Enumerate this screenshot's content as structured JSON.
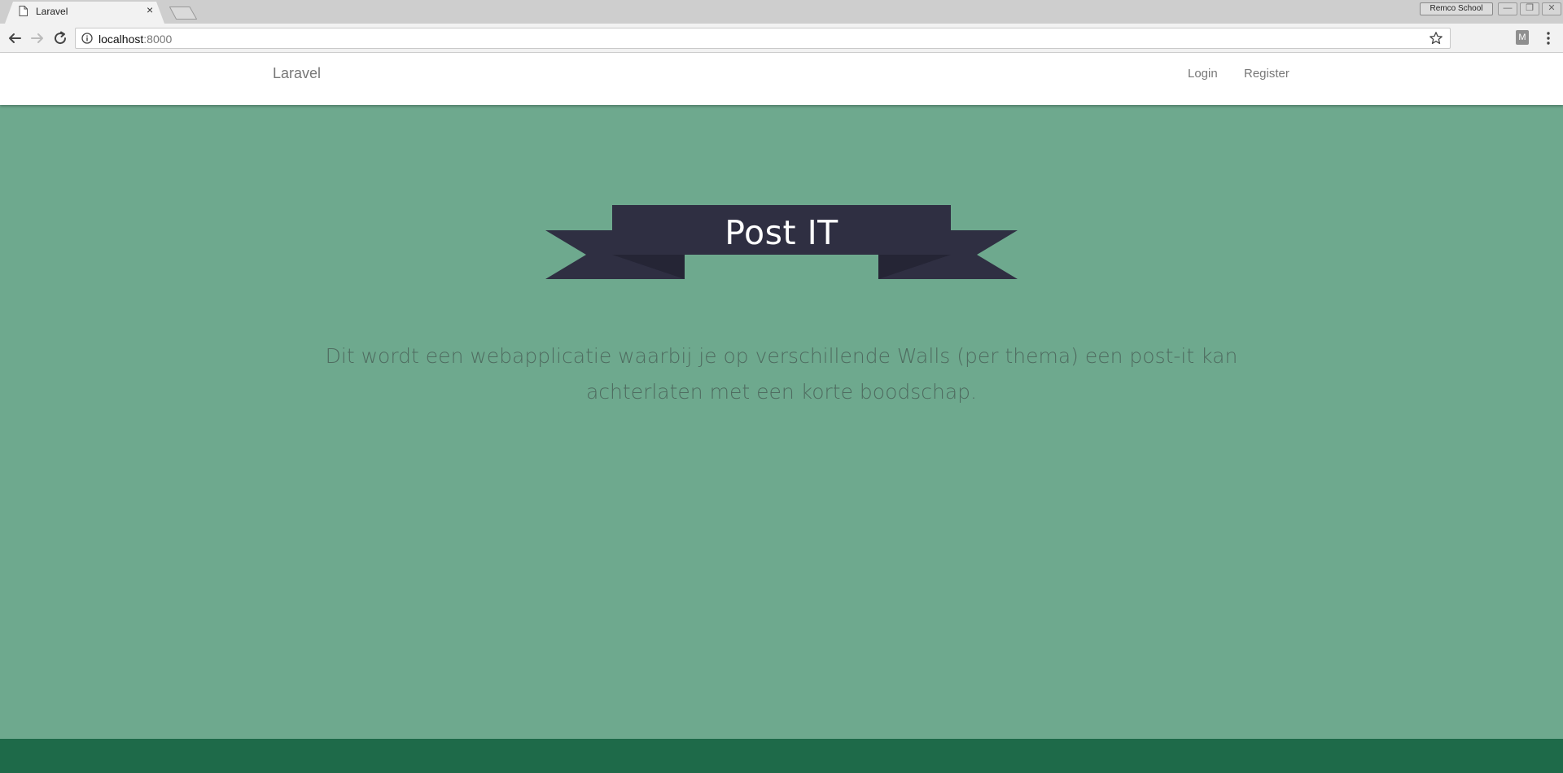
{
  "browser": {
    "tab_title": "Laravel",
    "tab_close": "×",
    "profile_name": "Remco School",
    "url_host": "localhost",
    "url_port": ":8000",
    "extension_letter": "M"
  },
  "navbar": {
    "brand": "Laravel",
    "links": [
      {
        "label": "Login"
      },
      {
        "label": "Register"
      }
    ]
  },
  "hero": {
    "ribbon_text": "Post IT",
    "description": "Dit wordt een webapplicatie waarbij je op verschillende Walls (per thema) een post-it kan achterlaten met een korte boodschap."
  },
  "colors": {
    "page_background": "#6ea98e",
    "ribbon": "#2f2f42",
    "ribbon_shadow": "#252535",
    "footer": "#1e6a49",
    "navbar": "#ffffff"
  },
  "icons": [
    "page-icon",
    "close-icon",
    "back-arrow-icon",
    "forward-arrow-icon",
    "reload-icon",
    "info-icon",
    "star-icon",
    "menu-icon"
  ]
}
